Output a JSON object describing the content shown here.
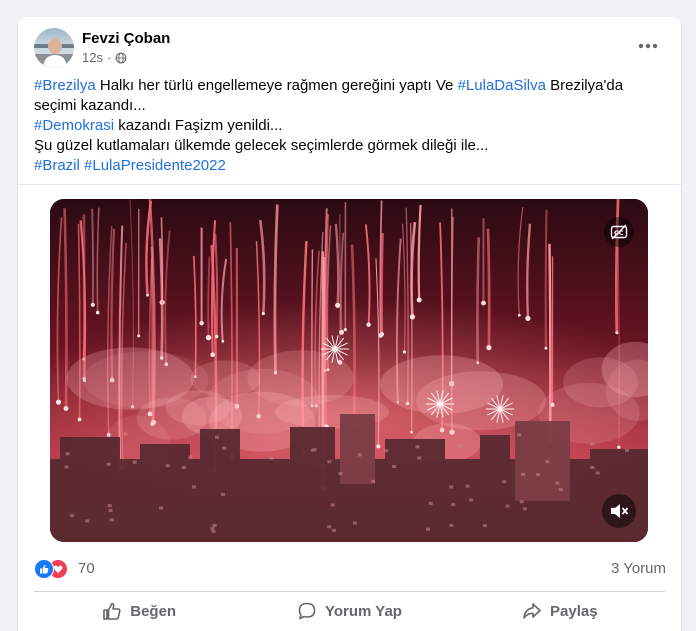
{
  "post": {
    "author": "Fevzi Çoban",
    "time": "12s",
    "separator": "·",
    "line1": {
      "tag1": "#Brezilya",
      "text1": " Halkı her türlü engellemeye rağmen gereğini yaptı Ve ",
      "tag2": "#LulaDaSilva",
      "text2": " Brezilya'da seçimi kazandı..."
    },
    "line2": {
      "tag": "#Demokrasi",
      "text": " kazandı Faşizm yenildi..."
    },
    "line3": "Şu güzel kutlamaları ülkemde gelecek seçimlerde görmek dileği ile...",
    "line4": {
      "tag1": "#Brazil",
      "space": " ",
      "tag2": "#LulaPresidente2022"
    }
  },
  "icons": {
    "more": "more-horizontal-icon",
    "globe": "globe-icon",
    "cc": "closed-captions-off-icon",
    "mute": "volume-muted-icon",
    "like_reaction": "like-reaction-icon",
    "love_reaction": "love-reaction-icon",
    "like": "thumbs-up-icon",
    "comment": "comment-bubble-icon",
    "share": "share-arrow-icon"
  },
  "stats": {
    "reaction_count": "70",
    "comment_count": "3 Yorum"
  },
  "actions": {
    "like": "Beğen",
    "comment": "Yorum Yap",
    "share": "Paylaş"
  },
  "colors": {
    "hashtag": "#216fdb",
    "like_blue": "#1877f2",
    "love_red": "#f33e58",
    "muted_text": "#65676b"
  }
}
